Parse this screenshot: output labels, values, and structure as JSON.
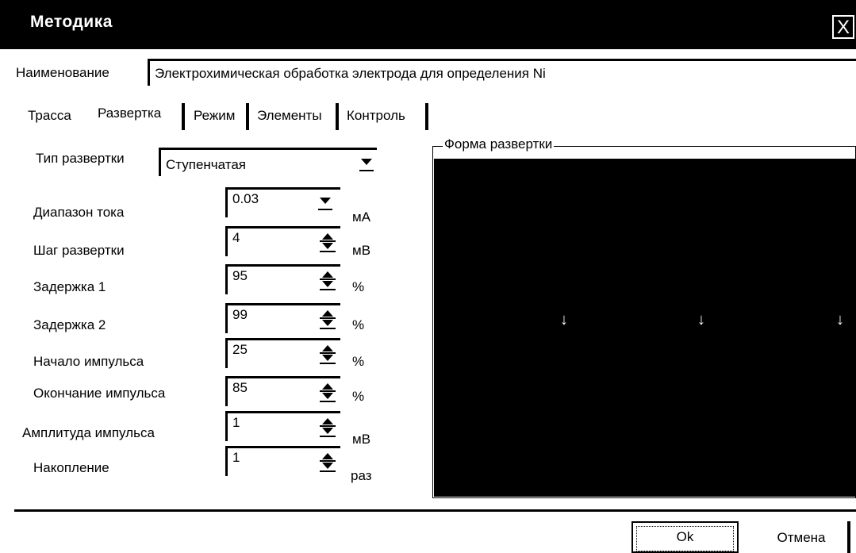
{
  "window": {
    "title": "Методика",
    "close_icon": "X"
  },
  "name_label": "Наименование",
  "name_value": "Электрохимическая обработка электрода для определения Ni",
  "tabs": [
    {
      "label": "Трасса"
    },
    {
      "label": "Развертка"
    },
    {
      "label": "Режим"
    },
    {
      "label": "Элементы"
    },
    {
      "label": "Контроль"
    }
  ],
  "active_tab": "Развертка",
  "sweep_type": {
    "label": "Тип развертки",
    "value": "Ступенчатая"
  },
  "fields": [
    {
      "label": "Диапазон тока",
      "value": "0.03",
      "unit": "мА",
      "control": "dropdown"
    },
    {
      "label": "Шаг развертки",
      "value": "4",
      "unit": "мВ",
      "control": "spinner"
    },
    {
      "label": "Задержка 1",
      "value": "95",
      "unit": "%",
      "control": "spinner"
    },
    {
      "label": "Задержка 2",
      "value": "99",
      "unit": "%",
      "control": "spinner"
    },
    {
      "label": "Начало импульса",
      "value": "25",
      "unit": "%",
      "control": "spinner"
    },
    {
      "label": "Окончание импульса",
      "value": "85",
      "unit": "%",
      "control": "spinner"
    },
    {
      "label": "Амплитуда импульса",
      "value": "1",
      "unit": "мВ",
      "control": "spinner"
    },
    {
      "label": "Накопление",
      "value": "1",
      "unit": "раз",
      "control": "spinner"
    }
  ],
  "waveform": {
    "title": "Форма развертки",
    "markers": [
      "↓",
      "↓",
      "↓"
    ]
  },
  "buttons": {
    "ok": "Ok",
    "cancel": "Отмена"
  },
  "colors": {
    "titlebar": "#000000",
    "canvas": "#000000",
    "background": "#ffffff"
  }
}
